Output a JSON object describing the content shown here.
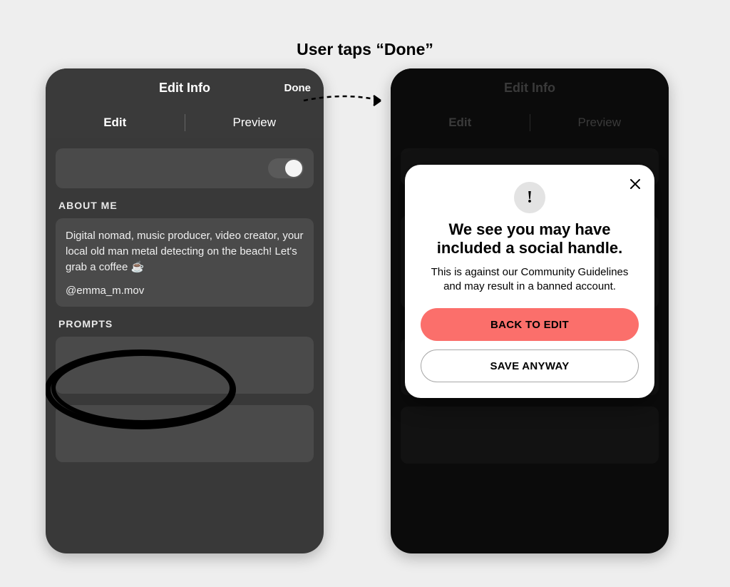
{
  "caption": "User taps “Done”",
  "screen_left": {
    "header": {
      "title": "Edit  Info",
      "done_label": "Done"
    },
    "tabs": {
      "edit_label": "Edit",
      "preview_label": "Preview"
    },
    "sections": {
      "about_label": "ABOUT ME",
      "about_text": "Digital nomad, music producer, video creator, your local old man metal detecting on the beach! Let's grab a coffee ☕",
      "about_handle": "@emma_m.mov",
      "prompts_label": "PROMPTS"
    },
    "toggle_on": true
  },
  "screen_right": {
    "header": {
      "title": "Edit  Info"
    },
    "tabs": {
      "edit_label": "Edit",
      "preview_label": "Preview"
    },
    "modal": {
      "icon_glyph": "!",
      "title": "We see you may have included a social handle.",
      "subtitle": "This is against our Community Guidelines and may result in a banned account.",
      "primary_label": "BACK TO EDIT",
      "secondary_label": "SAVE ANYWAY"
    }
  },
  "colors": {
    "primary_button": "#fb6f6b",
    "phone_bg_left": "#393939",
    "phone_bg_right": "#0b0b0b"
  }
}
